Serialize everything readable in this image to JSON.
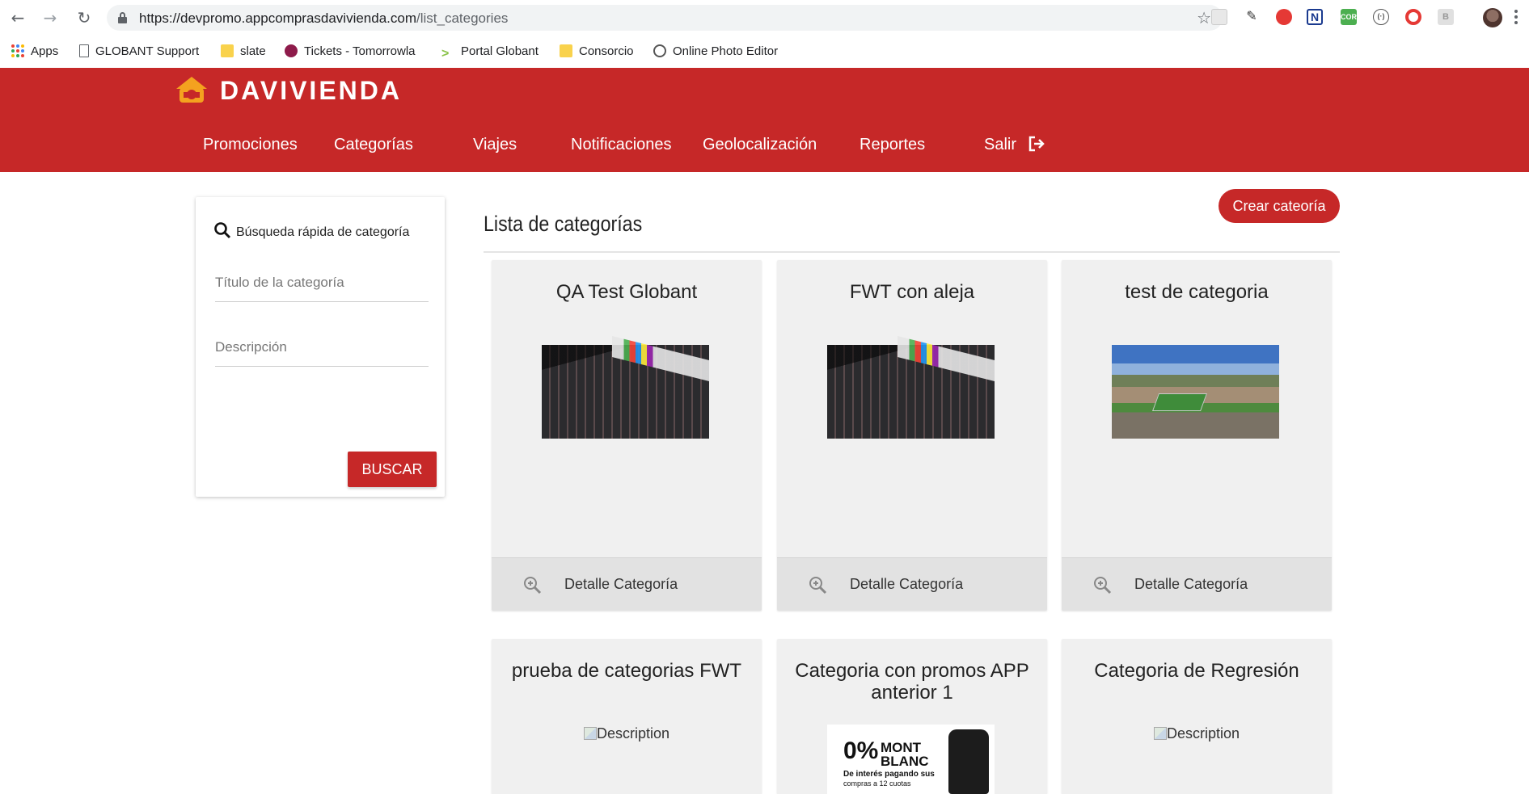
{
  "browser": {
    "url_host": "https://devpromo.appcomprasdavivienda.com",
    "url_path": "/list_categories",
    "bookmarks": [
      {
        "label": "Apps",
        "icon": "apps-grid-icon"
      },
      {
        "label": "GLOBANT Support",
        "icon": "page-icon"
      },
      {
        "label": "slate",
        "icon": "folder-icon"
      },
      {
        "label": "Tickets - Tomorrowla",
        "icon": "tickets-icon"
      },
      {
        "label": "Portal Globant",
        "icon": "globant-icon"
      },
      {
        "label": "Consorcio",
        "icon": "folder-icon"
      },
      {
        "label": "Online Photo Editor",
        "icon": "photo-editor-icon"
      }
    ]
  },
  "header": {
    "brand": "DAVIVIENDA",
    "nav": [
      "Promociones",
      "Categorías",
      "Viajes",
      "Notificaciones",
      "Geolocalización",
      "Reportes",
      "Salir"
    ],
    "brand_color": "#c62828"
  },
  "search": {
    "title": "Búsqueda rápida de categoría",
    "title_placeholder": "Título de la categoría",
    "description_placeholder": "Descripción",
    "button_label": "BUSCAR"
  },
  "main": {
    "title": "Lista de categorías",
    "create_button": "Crear cateoría",
    "detail_label": "Detalle Categoría",
    "broken_image_alt": "Description",
    "cards": [
      {
        "title": "QA Test Globant",
        "image": "laptop-keyboard"
      },
      {
        "title": "FWT con aleja",
        "image": "laptop-keyboard"
      },
      {
        "title": "test de categoria",
        "image": "campus-aerial"
      },
      {
        "title": "prueba de categorias FWT",
        "image": "broken"
      },
      {
        "title": "Categoria con promos APP anterior 1",
        "image": "promo-montblanc"
      },
      {
        "title": "Categoria de Regresión",
        "image": "broken"
      }
    ],
    "promo": {
      "percent": "0%",
      "brand_line1": "MONT",
      "brand_line2": "BLANC",
      "line1": "De interés pagando sus",
      "line2": "compras a 12 cuotas"
    }
  }
}
